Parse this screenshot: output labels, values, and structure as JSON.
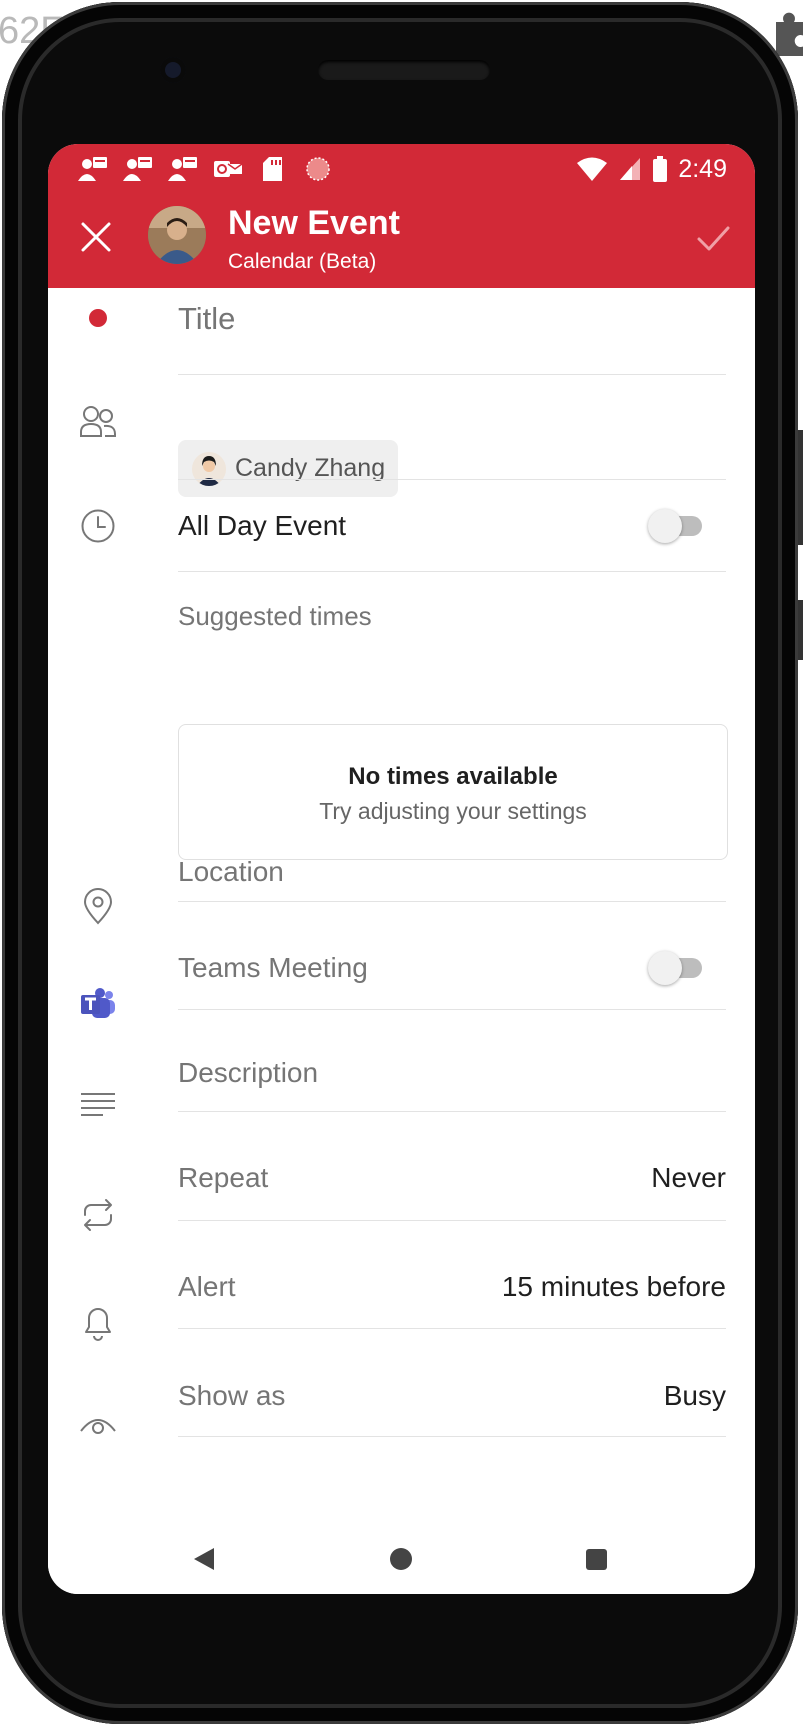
{
  "background": {
    "partial_text": "62F"
  },
  "status_bar": {
    "time": "2:49",
    "notification_icons": [
      "teams-notification-icon",
      "teams-notification-icon",
      "teams-notification-icon",
      "outlook-notification-icon",
      "sd-card-icon",
      "sync-icon"
    ]
  },
  "header": {
    "title": "New Event",
    "subtitle": "Calendar (Beta)",
    "accent_color": "#d22937"
  },
  "form": {
    "title_placeholder": "Title",
    "attendee_name": "Candy Zhang",
    "all_day_label": "All Day Event",
    "all_day_on": false,
    "suggested_label": "Suggested times",
    "no_times_title": "No times available",
    "no_times_subtitle": "Try adjusting your settings",
    "location_placeholder": "Location",
    "teams_label": "Teams Meeting",
    "teams_on": false,
    "description_placeholder": "Description",
    "repeat_label": "Repeat",
    "repeat_value": "Never",
    "alert_label": "Alert",
    "alert_value": "15 minutes before",
    "show_as_label": "Show as",
    "show_as_value": "Busy"
  }
}
